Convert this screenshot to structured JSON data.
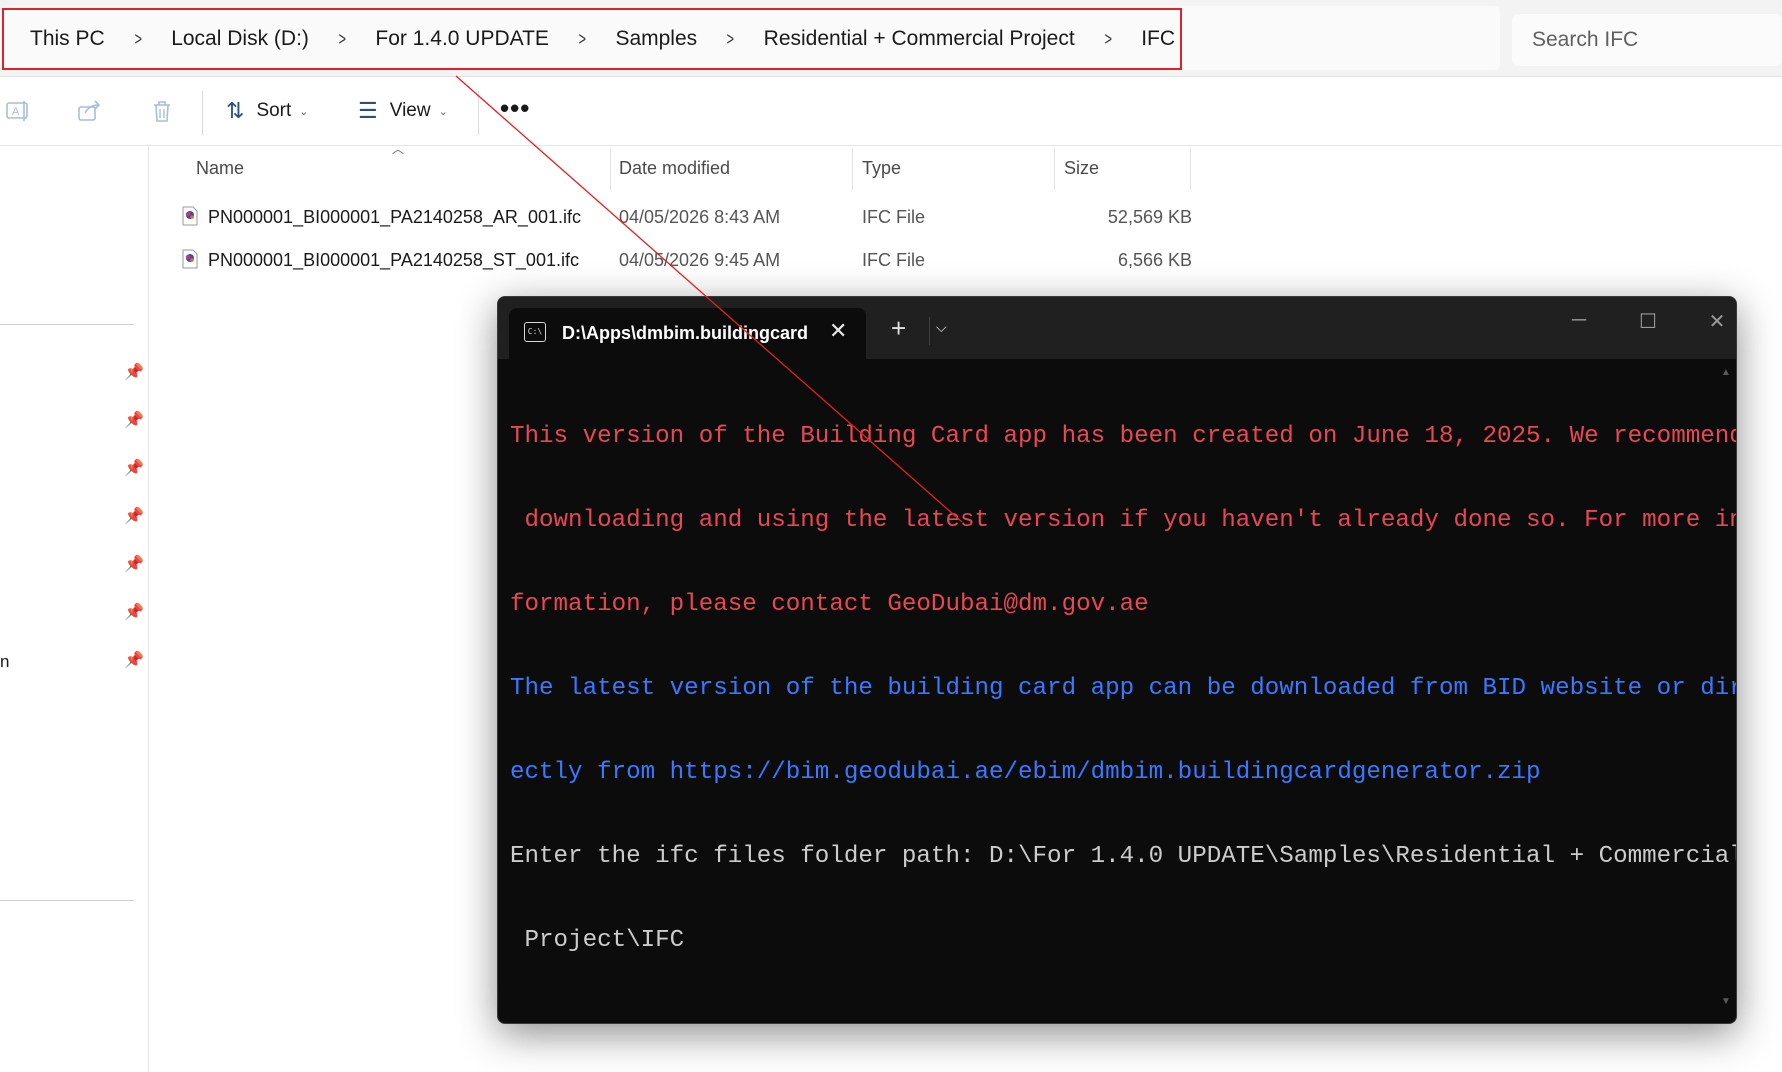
{
  "explorer": {
    "breadcrumb": [
      "This PC",
      "Local Disk (D:)",
      "For 1.4.0 UPDATE",
      "Samples",
      "Residential + Commercial Project",
      "IFC"
    ],
    "search_placeholder": "Search IFC",
    "toolbar": {
      "sort_label": "Sort",
      "view_label": "View",
      "more_label": "•••"
    },
    "columns": {
      "name": "Name",
      "date": "Date modified",
      "type": "Type",
      "size": "Size"
    },
    "files": [
      {
        "name": "PN000001_BI000001_PA2140258_AR_001.ifc",
        "date": "04/05/2026 8:43 AM",
        "type": "IFC File",
        "size": "52,569 KB"
      },
      {
        "name": "PN000001_BI000001_PA2140258_ST_001.ifc",
        "date": "04/05/2026 9:45 AM",
        "type": "IFC File",
        "size": "6,566 KB"
      }
    ],
    "nav_fragment": "n"
  },
  "terminal": {
    "tab_title": "D:\\Apps\\dmbim.buildingcard",
    "lines": [
      {
        "color": "red",
        "text": "This version of the Building Card app has been created on June 18, 2025. We recommend"
      },
      {
        "color": "red",
        "text": " downloading and using the latest version if you haven't already done so. For more in"
      },
      {
        "color": "red",
        "text": "formation, please contact GeoDubai@dm.gov.ae"
      },
      {
        "color": "blue",
        "text": "The latest version of the building card app can be downloaded from BID website or dir"
      },
      {
        "color": "blue",
        "text": "ectly from https://bim.geodubai.ae/ebim/dmbim.buildingcardgenerator.zip"
      },
      {
        "color": "white",
        "text": "Enter the ifc files folder path: D:\\For 1.4.0 UPDATE\\Samples\\Residential + Commercial"
      },
      {
        "color": "white",
        "text": " Project\\IFC"
      }
    ]
  },
  "colors": {
    "highlight_box": "#e02222",
    "terminal_red": "#e74856",
    "terminal_blue": "#3b78ff",
    "terminal_white": "#cccccc",
    "terminal_bg": "#0c0c0c"
  }
}
